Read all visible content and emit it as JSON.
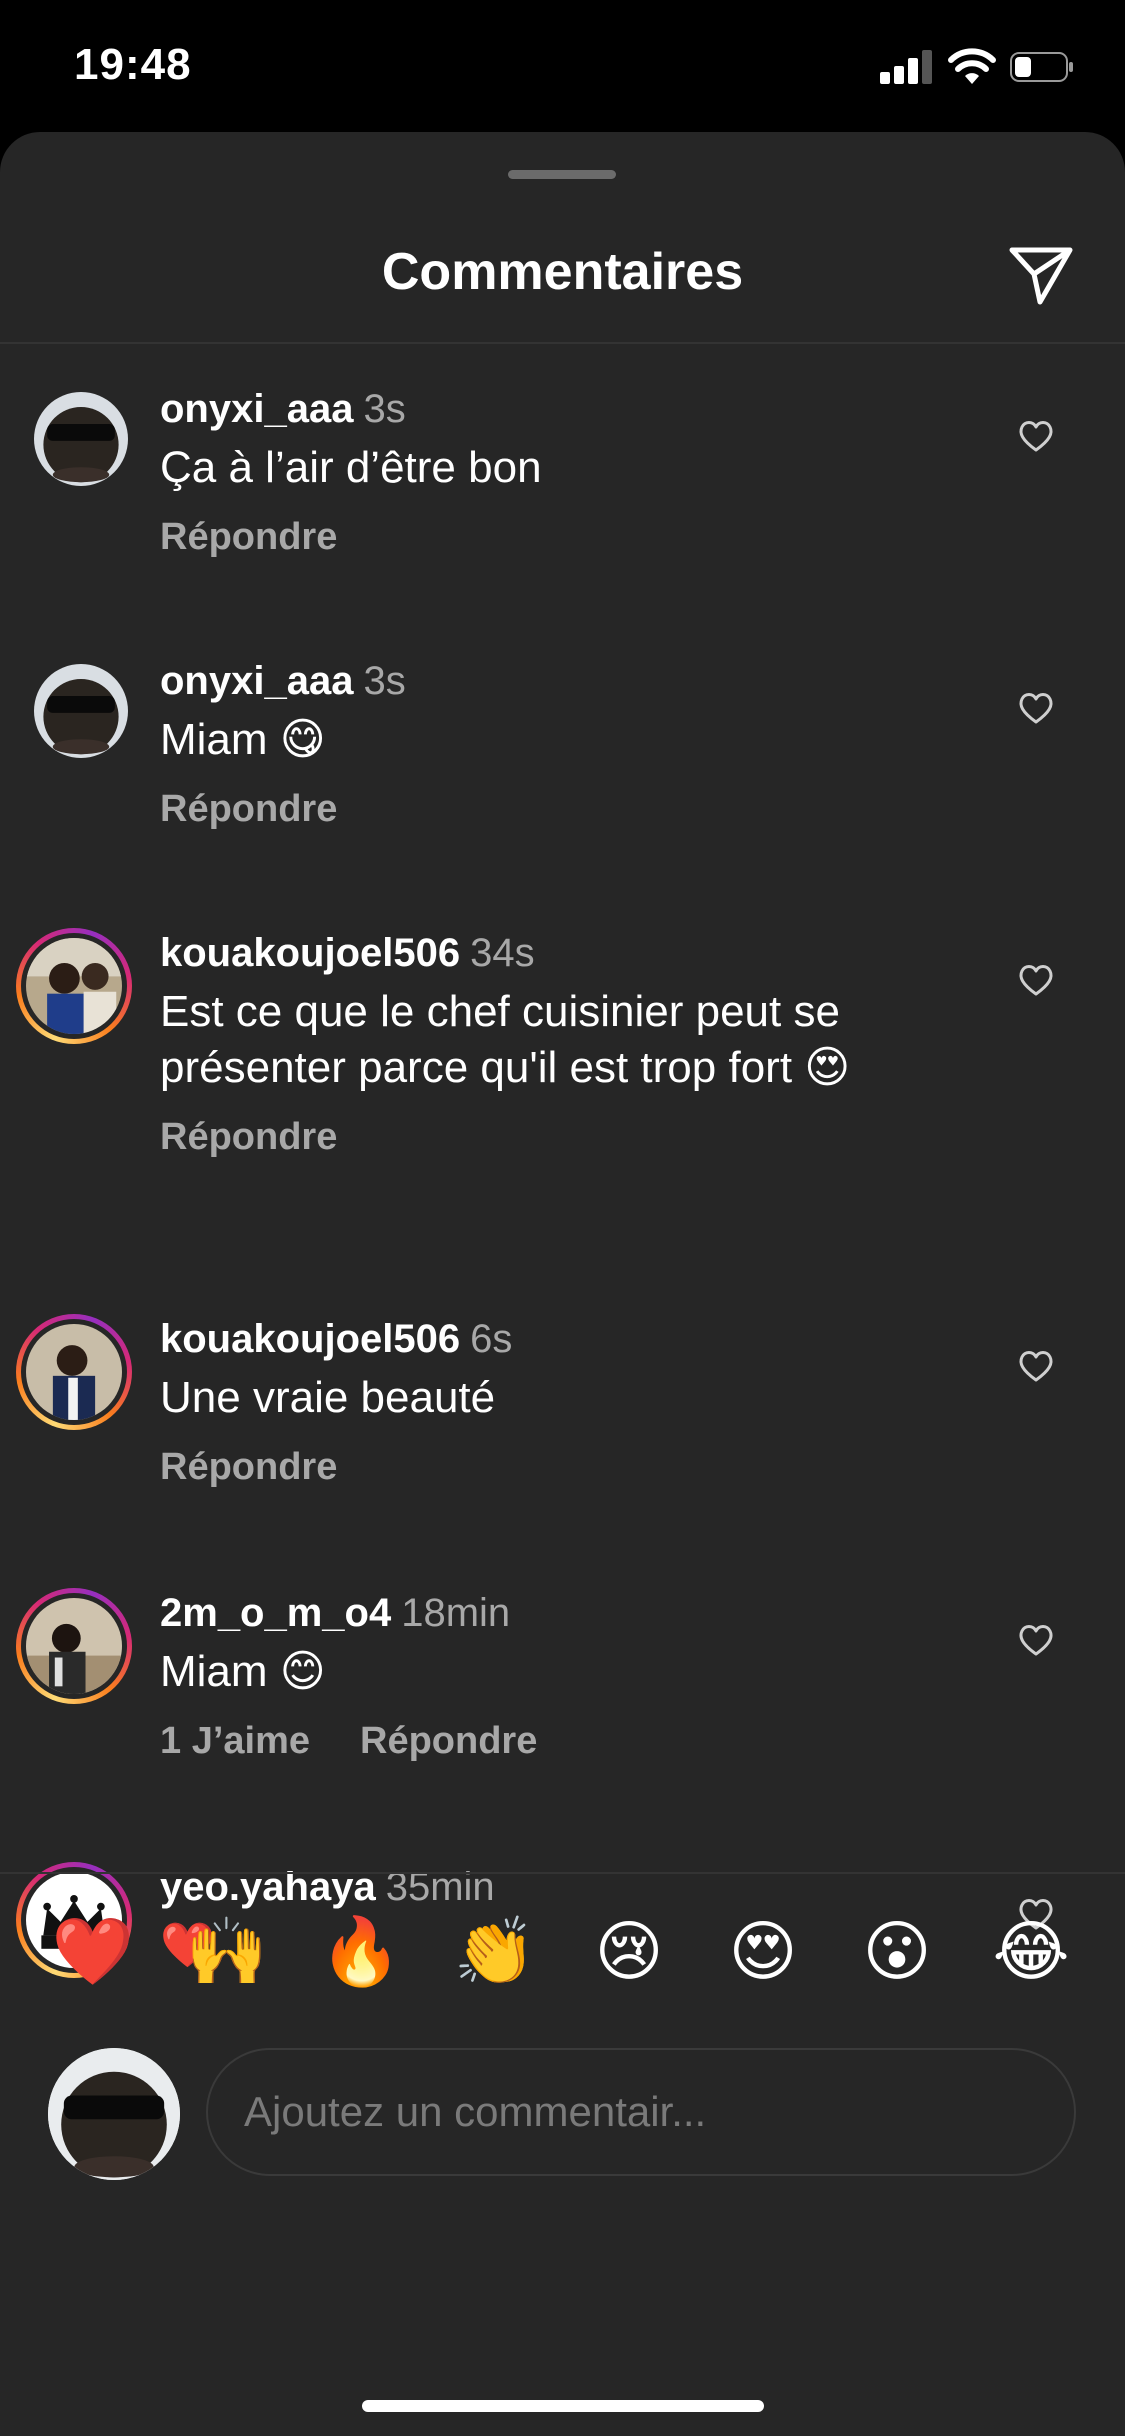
{
  "status_bar": {
    "time": "19:48",
    "icons": [
      "signal-icon",
      "wifi-icon",
      "battery-icon"
    ],
    "battery_level": 0.3
  },
  "header": {
    "title": "Commentaires",
    "share_icon": "send-icon"
  },
  "comments": [
    {
      "username": "onyxi_aaa",
      "time": "3s",
      "text": "Ça à l’air d’être bon",
      "reply_label": "Répondre",
      "story_ring": false
    },
    {
      "username": "onyxi_aaa",
      "time": "3s",
      "text": "Miam 😋",
      "reply_label": "Répondre",
      "story_ring": false
    },
    {
      "username": "kouakoujoel506",
      "time": "34s",
      "text": "Est ce que le chef cuisinier peut se présenter parce qu'il est trop fort 😍",
      "reply_label": "Répondre",
      "story_ring": true
    },
    {
      "username": "kouakoujoel506",
      "time": "6s",
      "text": "Une vraie beauté",
      "reply_label": "Répondre",
      "story_ring": true
    },
    {
      "username": "2m_o_m_o4",
      "time": "18min",
      "text": "Miam 😊",
      "likes_label": "1 J’aime",
      "reply_label": "Répondre",
      "story_ring": true
    },
    {
      "username": "yeo.yahaya",
      "time": "35min",
      "text": "❤️",
      "story_ring": true
    }
  ],
  "reactions": [
    "❤️",
    "🙌",
    "🔥",
    "👏",
    "😢",
    "😍",
    "😮",
    "😂"
  ],
  "composer": {
    "placeholder": "Ajoutez un commentair..."
  },
  "colors": {
    "background": "#262626",
    "secondary_text": "#a8a8a8",
    "story_ring": [
      "#feda75",
      "#d62976",
      "#962fbf"
    ]
  }
}
